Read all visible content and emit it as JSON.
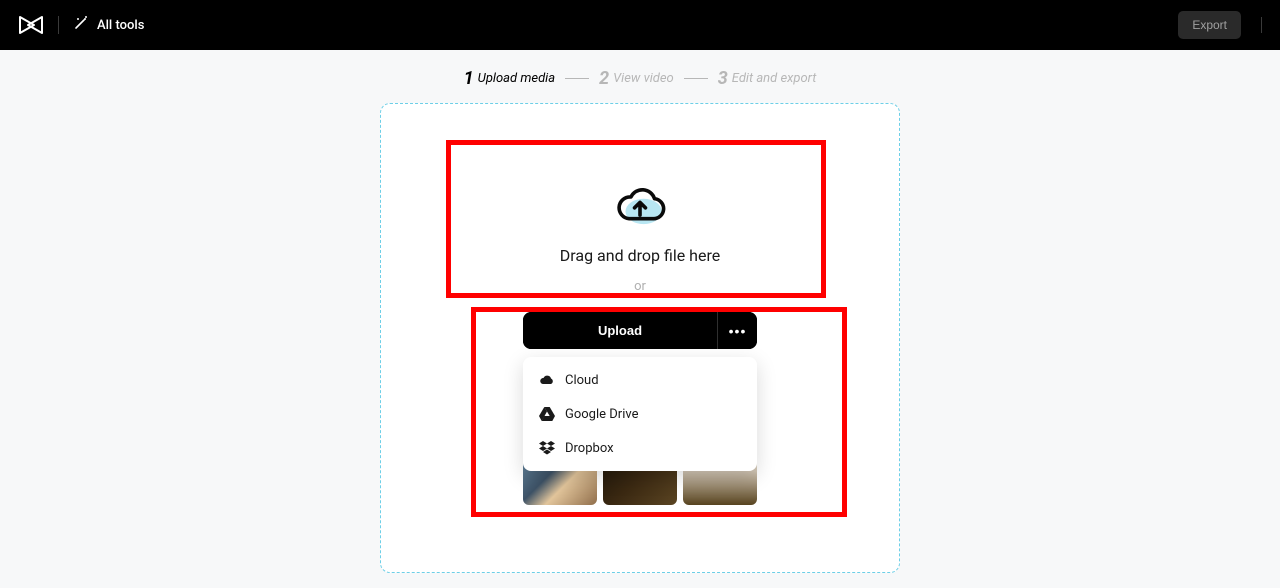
{
  "header": {
    "all_tools_label": "All tools",
    "export_label": "Export"
  },
  "steps": [
    {
      "num": "1",
      "label": "Upload media",
      "active": true
    },
    {
      "num": "2",
      "label": "View video",
      "active": false
    },
    {
      "num": "3",
      "label": "Edit and export",
      "active": false
    }
  ],
  "drop": {
    "text": "Drag and drop file here",
    "or": "or",
    "upload_label": "Upload",
    "more_label": "•••"
  },
  "dropdown": [
    {
      "icon": "cloud",
      "label": "Cloud"
    },
    {
      "icon": "gdrive",
      "label": "Google Drive"
    },
    {
      "icon": "dropbox",
      "label": "Dropbox"
    }
  ]
}
